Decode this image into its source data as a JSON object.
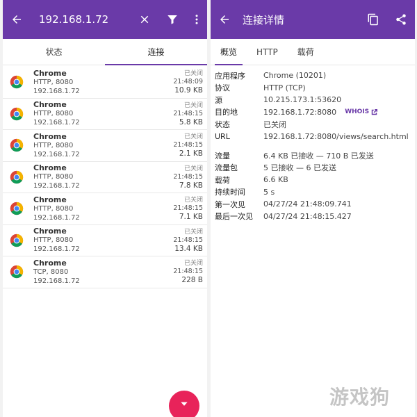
{
  "left": {
    "header": {
      "title": "192.168.1.72"
    },
    "tabs": [
      {
        "label": "状态"
      },
      {
        "label": "连接"
      }
    ],
    "connections": [
      {
        "app": "Chrome",
        "proto": "HTTP, 8080",
        "ip": "192.168.1.72",
        "status": "已关闭",
        "time": "21:48:09",
        "size": "10.9 KB"
      },
      {
        "app": "Chrome",
        "proto": "HTTP, 8080",
        "ip": "192.168.1.72",
        "status": "已关闭",
        "time": "21:48:15",
        "size": "5.8 KB"
      },
      {
        "app": "Chrome",
        "proto": "HTTP, 8080",
        "ip": "192.168.1.72",
        "status": "已关闭",
        "time": "21:48:15",
        "size": "2.1 KB"
      },
      {
        "app": "Chrome",
        "proto": "HTTP, 8080",
        "ip": "192.168.1.72",
        "status": "已关闭",
        "time": "21:48:15",
        "size": "7.8 KB"
      },
      {
        "app": "Chrome",
        "proto": "HTTP, 8080",
        "ip": "192.168.1.72",
        "status": "已关闭",
        "time": "21:48:15",
        "size": "7.1 KB"
      },
      {
        "app": "Chrome",
        "proto": "HTTP, 8080",
        "ip": "192.168.1.72",
        "status": "已关闭",
        "time": "21:48:15",
        "size": "13.4 KB"
      },
      {
        "app": "Chrome",
        "proto": "TCP, 8080",
        "ip": "192.168.1.72",
        "status": "已关闭",
        "time": "21:48:15",
        "size": "228 B"
      }
    ]
  },
  "right": {
    "header": {
      "title": "连接详情"
    },
    "tabs": [
      {
        "label": "概览"
      },
      {
        "label": "HTTP"
      },
      {
        "label": "载荷"
      }
    ],
    "whois_label": "WHOIS",
    "details_a": [
      {
        "key": "应用程序",
        "value": "Chrome (10201)"
      },
      {
        "key": "协议",
        "value": "HTTP (TCP)"
      },
      {
        "key": "源",
        "value": "10.215.173.1:53620"
      },
      {
        "key": "目的地",
        "value": "192.168.1.72:8080"
      },
      {
        "key": "状态",
        "value": "已关闭"
      },
      {
        "key": "URL",
        "value": "192.168.1.72:8080/views/search.html"
      }
    ],
    "details_b": [
      {
        "key": "流量",
        "value": "6.4 KB 已接收 — 710 B 已发送"
      },
      {
        "key": "流量包",
        "value": "5 已接收 — 6 已发送"
      },
      {
        "key": "载荷",
        "value": "6.6 KB"
      },
      {
        "key": "持续时间",
        "value": "5 s"
      },
      {
        "key": "第一次见",
        "value": "04/27/24 21:48:09.741"
      },
      {
        "key": "最后一次见",
        "value": "04/27/24 21:48:15.427"
      }
    ]
  },
  "watermark": "游戏狗",
  "colors": {
    "appbar": "#6a3aa8",
    "fab": "#e8235a",
    "accent": "#6a3aa8"
  },
  "icons": [
    "back-arrow-icon",
    "close-icon",
    "filter-icon",
    "more-vert-icon",
    "copy-icon",
    "share-icon",
    "chrome-icon",
    "external-link-icon",
    "chevron-down-icon"
  ]
}
